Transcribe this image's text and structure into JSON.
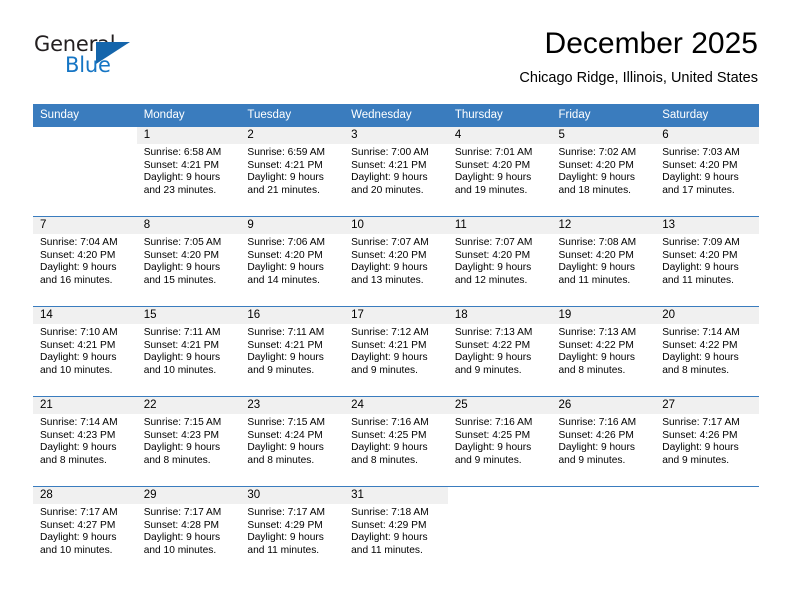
{
  "brand": {
    "name_part1": "General",
    "name_part2": "Blue",
    "accent_color": "#1575c4",
    "triangle_color": "#1565ab"
  },
  "header": {
    "title": "December 2025",
    "location": "Chicago Ridge, Illinois, United States",
    "header_bg_color": "#3a7cbe",
    "daynum_band_color": "#f0f0f0"
  },
  "weekday_headers": [
    "Sunday",
    "Monday",
    "Tuesday",
    "Wednesday",
    "Thursday",
    "Friday",
    "Saturday"
  ],
  "weeks": [
    [
      {
        "day": "",
        "sunrise": "",
        "sunset": "",
        "daylight_line1": "",
        "daylight_line2": ""
      },
      {
        "day": "1",
        "sunrise": "Sunrise: 6:58 AM",
        "sunset": "Sunset: 4:21 PM",
        "daylight_line1": "Daylight: 9 hours",
        "daylight_line2": "and 23 minutes."
      },
      {
        "day": "2",
        "sunrise": "Sunrise: 6:59 AM",
        "sunset": "Sunset: 4:21 PM",
        "daylight_line1": "Daylight: 9 hours",
        "daylight_line2": "and 21 minutes."
      },
      {
        "day": "3",
        "sunrise": "Sunrise: 7:00 AM",
        "sunset": "Sunset: 4:21 PM",
        "daylight_line1": "Daylight: 9 hours",
        "daylight_line2": "and 20 minutes."
      },
      {
        "day": "4",
        "sunrise": "Sunrise: 7:01 AM",
        "sunset": "Sunset: 4:20 PM",
        "daylight_line1": "Daylight: 9 hours",
        "daylight_line2": "and 19 minutes."
      },
      {
        "day": "5",
        "sunrise": "Sunrise: 7:02 AM",
        "sunset": "Sunset: 4:20 PM",
        "daylight_line1": "Daylight: 9 hours",
        "daylight_line2": "and 18 minutes."
      },
      {
        "day": "6",
        "sunrise": "Sunrise: 7:03 AM",
        "sunset": "Sunset: 4:20 PM",
        "daylight_line1": "Daylight: 9 hours",
        "daylight_line2": "and 17 minutes."
      }
    ],
    [
      {
        "day": "7",
        "sunrise": "Sunrise: 7:04 AM",
        "sunset": "Sunset: 4:20 PM",
        "daylight_line1": "Daylight: 9 hours",
        "daylight_line2": "and 16 minutes."
      },
      {
        "day": "8",
        "sunrise": "Sunrise: 7:05 AM",
        "sunset": "Sunset: 4:20 PM",
        "daylight_line1": "Daylight: 9 hours",
        "daylight_line2": "and 15 minutes."
      },
      {
        "day": "9",
        "sunrise": "Sunrise: 7:06 AM",
        "sunset": "Sunset: 4:20 PM",
        "daylight_line1": "Daylight: 9 hours",
        "daylight_line2": "and 14 minutes."
      },
      {
        "day": "10",
        "sunrise": "Sunrise: 7:07 AM",
        "sunset": "Sunset: 4:20 PM",
        "daylight_line1": "Daylight: 9 hours",
        "daylight_line2": "and 13 minutes."
      },
      {
        "day": "11",
        "sunrise": "Sunrise: 7:07 AM",
        "sunset": "Sunset: 4:20 PM",
        "daylight_line1": "Daylight: 9 hours",
        "daylight_line2": "and 12 minutes."
      },
      {
        "day": "12",
        "sunrise": "Sunrise: 7:08 AM",
        "sunset": "Sunset: 4:20 PM",
        "daylight_line1": "Daylight: 9 hours",
        "daylight_line2": "and 11 minutes."
      },
      {
        "day": "13",
        "sunrise": "Sunrise: 7:09 AM",
        "sunset": "Sunset: 4:20 PM",
        "daylight_line1": "Daylight: 9 hours",
        "daylight_line2": "and 11 minutes."
      }
    ],
    [
      {
        "day": "14",
        "sunrise": "Sunrise: 7:10 AM",
        "sunset": "Sunset: 4:21 PM",
        "daylight_line1": "Daylight: 9 hours",
        "daylight_line2": "and 10 minutes."
      },
      {
        "day": "15",
        "sunrise": "Sunrise: 7:11 AM",
        "sunset": "Sunset: 4:21 PM",
        "daylight_line1": "Daylight: 9 hours",
        "daylight_line2": "and 10 minutes."
      },
      {
        "day": "16",
        "sunrise": "Sunrise: 7:11 AM",
        "sunset": "Sunset: 4:21 PM",
        "daylight_line1": "Daylight: 9 hours",
        "daylight_line2": "and 9 minutes."
      },
      {
        "day": "17",
        "sunrise": "Sunrise: 7:12 AM",
        "sunset": "Sunset: 4:21 PM",
        "daylight_line1": "Daylight: 9 hours",
        "daylight_line2": "and 9 minutes."
      },
      {
        "day": "18",
        "sunrise": "Sunrise: 7:13 AM",
        "sunset": "Sunset: 4:22 PM",
        "daylight_line1": "Daylight: 9 hours",
        "daylight_line2": "and 9 minutes."
      },
      {
        "day": "19",
        "sunrise": "Sunrise: 7:13 AM",
        "sunset": "Sunset: 4:22 PM",
        "daylight_line1": "Daylight: 9 hours",
        "daylight_line2": "and 8 minutes."
      },
      {
        "day": "20",
        "sunrise": "Sunrise: 7:14 AM",
        "sunset": "Sunset: 4:22 PM",
        "daylight_line1": "Daylight: 9 hours",
        "daylight_line2": "and 8 minutes."
      }
    ],
    [
      {
        "day": "21",
        "sunrise": "Sunrise: 7:14 AM",
        "sunset": "Sunset: 4:23 PM",
        "daylight_line1": "Daylight: 9 hours",
        "daylight_line2": "and 8 minutes."
      },
      {
        "day": "22",
        "sunrise": "Sunrise: 7:15 AM",
        "sunset": "Sunset: 4:23 PM",
        "daylight_line1": "Daylight: 9 hours",
        "daylight_line2": "and 8 minutes."
      },
      {
        "day": "23",
        "sunrise": "Sunrise: 7:15 AM",
        "sunset": "Sunset: 4:24 PM",
        "daylight_line1": "Daylight: 9 hours",
        "daylight_line2": "and 8 minutes."
      },
      {
        "day": "24",
        "sunrise": "Sunrise: 7:16 AM",
        "sunset": "Sunset: 4:25 PM",
        "daylight_line1": "Daylight: 9 hours",
        "daylight_line2": "and 8 minutes."
      },
      {
        "day": "25",
        "sunrise": "Sunrise: 7:16 AM",
        "sunset": "Sunset: 4:25 PM",
        "daylight_line1": "Daylight: 9 hours",
        "daylight_line2": "and 9 minutes."
      },
      {
        "day": "26",
        "sunrise": "Sunrise: 7:16 AM",
        "sunset": "Sunset: 4:26 PM",
        "daylight_line1": "Daylight: 9 hours",
        "daylight_line2": "and 9 minutes."
      },
      {
        "day": "27",
        "sunrise": "Sunrise: 7:17 AM",
        "sunset": "Sunset: 4:26 PM",
        "daylight_line1": "Daylight: 9 hours",
        "daylight_line2": "and 9 minutes."
      }
    ],
    [
      {
        "day": "28",
        "sunrise": "Sunrise: 7:17 AM",
        "sunset": "Sunset: 4:27 PM",
        "daylight_line1": "Daylight: 9 hours",
        "daylight_line2": "and 10 minutes."
      },
      {
        "day": "29",
        "sunrise": "Sunrise: 7:17 AM",
        "sunset": "Sunset: 4:28 PM",
        "daylight_line1": "Daylight: 9 hours",
        "daylight_line2": "and 10 minutes."
      },
      {
        "day": "30",
        "sunrise": "Sunrise: 7:17 AM",
        "sunset": "Sunset: 4:29 PM",
        "daylight_line1": "Daylight: 9 hours",
        "daylight_line2": "and 11 minutes."
      },
      {
        "day": "31",
        "sunrise": "Sunrise: 7:18 AM",
        "sunset": "Sunset: 4:29 PM",
        "daylight_line1": "Daylight: 9 hours",
        "daylight_line2": "and 11 minutes."
      },
      {
        "day": "",
        "sunrise": "",
        "sunset": "",
        "daylight_line1": "",
        "daylight_line2": ""
      },
      {
        "day": "",
        "sunrise": "",
        "sunset": "",
        "daylight_line1": "",
        "daylight_line2": ""
      },
      {
        "day": "",
        "sunrise": "",
        "sunset": "",
        "daylight_line1": "",
        "daylight_line2": ""
      }
    ]
  ]
}
